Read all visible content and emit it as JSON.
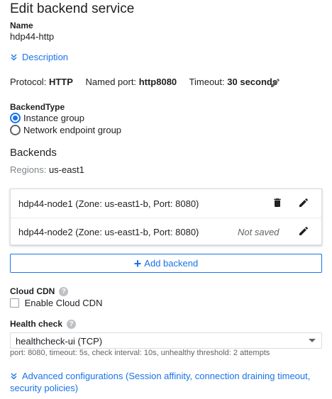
{
  "page": {
    "title": "Edit backend service"
  },
  "name": {
    "label": "Name",
    "value": "hdp44-http"
  },
  "description": {
    "link": "Description"
  },
  "protocol": {
    "protocol_label": "Protocol:",
    "protocol_value": "HTTP",
    "port_label": "Named port:",
    "port_value": "http8080",
    "timeout_label": "Timeout:",
    "timeout_value": "30 seconds",
    "edit_icon": "pencil-icon"
  },
  "backend_type": {
    "label": "BackendType",
    "options": [
      {
        "label": "Instance group",
        "selected": true
      },
      {
        "label": "Network endpoint group",
        "selected": false
      }
    ]
  },
  "backends": {
    "heading": "Backends",
    "regions_label": "Regions:",
    "regions_value": "us-east1",
    "rows": [
      {
        "name": "hdp44-node1 (Zone: us-east1-b, Port: 8080)",
        "status": "",
        "icons": [
          "trash-icon",
          "pencil-icon"
        ]
      },
      {
        "name": "hdp44-node2 (Zone: us-east1-b, Port: 8080)",
        "status": "Not saved",
        "icons": [
          "pencil-icon"
        ]
      }
    ],
    "add_button": "Add backend"
  },
  "cdn": {
    "label": "Cloud CDN",
    "checkbox_label": "Enable Cloud CDN",
    "checked": false
  },
  "health_check": {
    "label": "Health check",
    "selected": "healthcheck-ui (TCP)",
    "hint": "port: 8080, timeout: 5s, check interval: 10s, unhealthy threshold: 2 attempts"
  },
  "advanced": {
    "link": "Advanced configurations (Session affinity, connection draining timeout, security policies)"
  },
  "colors": {
    "accent": "#1a73e8",
    "text": "#202124",
    "muted": "#5f6368"
  }
}
